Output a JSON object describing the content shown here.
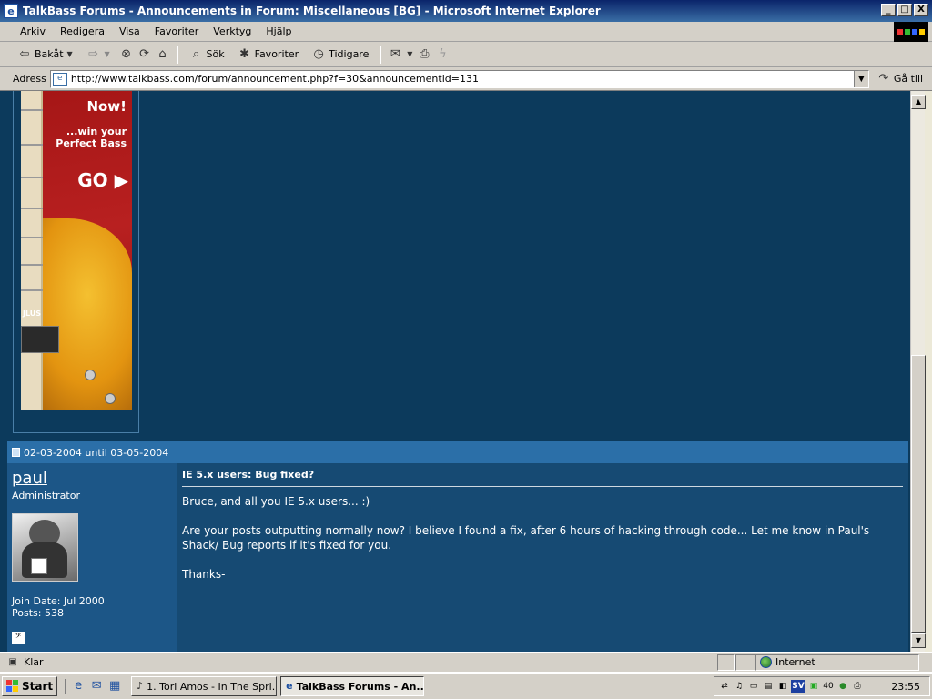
{
  "window": {
    "title": "TalkBass Forums - Announcements in Forum: Miscellaneous [BG] - Microsoft Internet Explorer",
    "buttons": [
      "_",
      "□",
      "X"
    ]
  },
  "menu": [
    "Arkiv",
    "Redigera",
    "Visa",
    "Favoriter",
    "Verktyg",
    "Hjälp"
  ],
  "toolbar": {
    "back": "Bakåt",
    "search": "Sök",
    "favorites": "Favoriter",
    "history": "Tidigare"
  },
  "address": {
    "label": "Adress",
    "url": "http://www.talkbass.com/forum/announcement.php?f=30&announcementid=131",
    "go": "Gå till"
  },
  "ad": {
    "headline": "Now!",
    "tagline": "...win your Perfect Bass",
    "cta": "GO ▶",
    "brand": "JLUS"
  },
  "post": {
    "date_range": "02-03-2004 until 03-05-2004",
    "user": {
      "name": "paul",
      "title": "Administrator",
      "join_date": "Join Date: Jul 2000",
      "posts": "Posts: 538"
    },
    "title": "IE 5.x users: Bug fixed?",
    "paragraphs": [
      "Bruce, and all you IE 5.x users... :)",
      "Are your posts outputting normally now? I believe I found a fix, after 6 hours of hacking through code... Let me know in Paul's Shack/ Bug reports if it's fixed for you.",
      "Thanks-"
    ]
  },
  "status": {
    "text": "Klar",
    "zone": "Internet"
  },
  "taskbar": {
    "start": "Start",
    "tasks": [
      {
        "label": "1. Tori Amos - In The Spri..."
      },
      {
        "label": "TalkBass Forums - An..."
      }
    ],
    "tray_lang": "SV",
    "tray_num": "40",
    "clock": "23:55"
  },
  "colors": {
    "page_bg": "#0c3a5c",
    "post_header": "#2b6fa8",
    "user_col": "#1c5687",
    "msg_col": "#164a73"
  }
}
